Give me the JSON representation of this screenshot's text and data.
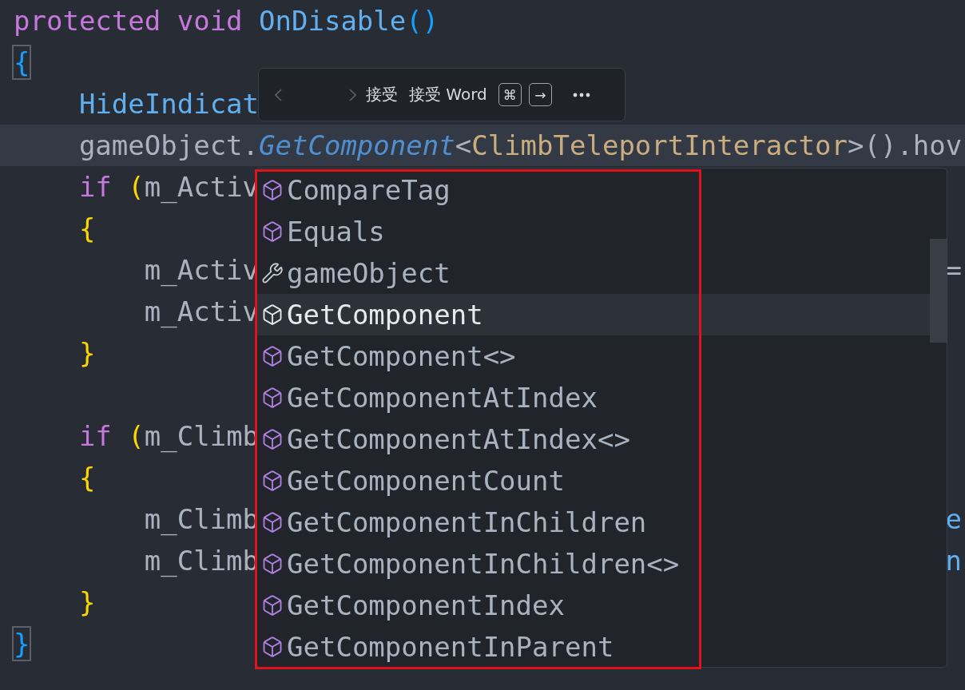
{
  "editor": {
    "lines": [
      {
        "current": false,
        "tokens": [
          {
            "kind": "keyword",
            "text": "protected void"
          },
          {
            "kind": "function",
            "text": "OnDisable",
            "gap": true
          },
          {
            "kind": "paren-blue",
            "text": "()"
          }
        ]
      },
      {
        "current": false,
        "tokens": [
          {
            "kind": "brace-matched",
            "text": "{"
          }
        ],
        "children": [
          {
            "current": false,
            "tokens": [
              {
                "kind": "function",
                "text": "HideIndicat"
              }
            ]
          },
          {
            "current": true,
            "tokens": [
              {
                "kind": "plain",
                "text": "gameObject."
              },
              {
                "kind": "method",
                "text": "GetComponent"
              },
              {
                "kind": "plain",
                "text": "<"
              },
              {
                "kind": "type",
                "text": "ClimbTeleportInteractor"
              },
              {
                "kind": "plain",
                "text": ">().hov"
              }
            ]
          },
          {
            "current": false,
            "tokens": [
              {
                "kind": "keyword",
                "text": "if"
              },
              {
                "kind": "paren-yellow",
                "text": "(",
                "gap": true
              },
              {
                "kind": "plain",
                "text": "m_Activ"
              }
            ]
          },
          {
            "current": false,
            "tokens": [
              {
                "kind": "brace-yellow",
                "text": "{"
              }
            ],
            "children": [
              {
                "current": false,
                "tokens": [
                  {
                    "kind": "plain",
                    "text": "m_Activ"
                  }
                ],
                "right": {
                  "kind": "plain",
                  "text": "="
                }
              },
              {
                "current": false,
                "tokens": [
                  {
                    "kind": "plain",
                    "text": "m_Activ"
                  }
                ]
              }
            ]
          },
          {
            "current": false,
            "tokens": [
              {
                "kind": "brace-yellow",
                "text": "}"
              }
            ]
          },
          {
            "current": false
          },
          {
            "current": false,
            "tokens": [
              {
                "kind": "keyword",
                "text": "if"
              },
              {
                "kind": "paren-yellow",
                "text": "(",
                "gap": true
              },
              {
                "kind": "plain",
                "text": "m_Climb"
              }
            ]
          },
          {
            "current": false,
            "tokens": [
              {
                "kind": "brace-yellow",
                "text": "{"
              }
            ],
            "children": [
              {
                "current": false,
                "tokens": [
                  {
                    "kind": "plain",
                    "text": "m_Climb"
                  }
                ],
                "right": {
                  "kind": "function",
                  "text": "e"
                }
              },
              {
                "current": false,
                "tokens": [
                  {
                    "kind": "plain",
                    "text": "m_Climb"
                  }
                ],
                "right": {
                  "kind": "function",
                  "text": "n"
                }
              }
            ]
          },
          {
            "current": false,
            "tokens": [
              {
                "kind": "brace-yellow",
                "text": "}"
              }
            ]
          }
        ]
      },
      {
        "current": false,
        "tokens": [
          {
            "kind": "brace-matched",
            "text": "}"
          }
        ]
      }
    ]
  },
  "inline_toolbar": {
    "previous_disabled": true,
    "next_disabled": true,
    "accept": "接受",
    "accept_word": "接受 Word",
    "keys": [
      "⌘",
      "→"
    ]
  },
  "suggestions": {
    "items": [
      {
        "kind": "method",
        "label": "CompareTag",
        "selected": false
      },
      {
        "kind": "method",
        "label": "Equals",
        "selected": false
      },
      {
        "kind": "property",
        "label": "gameObject",
        "selected": false
      },
      {
        "kind": "method",
        "label": "GetComponent",
        "selected": true
      },
      {
        "kind": "method",
        "label": "GetComponent<>",
        "selected": false
      },
      {
        "kind": "method",
        "label": "GetComponentAtIndex",
        "selected": false
      },
      {
        "kind": "method",
        "label": "GetComponentAtIndex<>",
        "selected": false
      },
      {
        "kind": "method",
        "label": "GetComponentCount",
        "selected": false
      },
      {
        "kind": "method",
        "label": "GetComponentInChildren",
        "selected": false
      },
      {
        "kind": "method",
        "label": "GetComponentInChildren<>",
        "selected": false
      },
      {
        "kind": "method",
        "label": "GetComponentIndex",
        "selected": false
      },
      {
        "kind": "method",
        "label": "GetComponentInParent",
        "selected": false
      }
    ]
  }
}
